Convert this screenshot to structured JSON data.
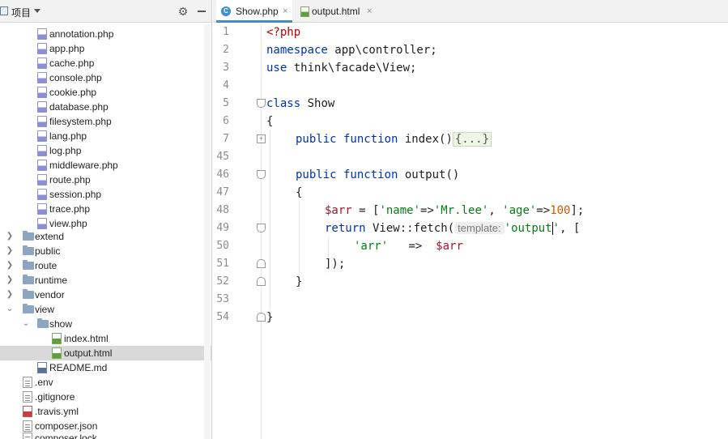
{
  "project_panel": {
    "title": "项目",
    "items": [
      {
        "label": "annotation.php",
        "icon": "php-file-icon"
      },
      {
        "label": "app.php",
        "icon": "php-file-icon"
      },
      {
        "label": "cache.php",
        "icon": "php-file-icon"
      },
      {
        "label": "console.php",
        "icon": "php-file-icon"
      },
      {
        "label": "cookie.php",
        "icon": "php-file-icon"
      },
      {
        "label": "database.php",
        "icon": "php-file-icon"
      },
      {
        "label": "filesystem.php",
        "icon": "php-file-icon"
      },
      {
        "label": "lang.php",
        "icon": "php-file-icon"
      },
      {
        "label": "log.php",
        "icon": "php-file-icon"
      },
      {
        "label": "middleware.php",
        "icon": "php-file-icon"
      },
      {
        "label": "route.php",
        "icon": "php-file-icon"
      },
      {
        "label": "session.php",
        "icon": "php-file-icon"
      },
      {
        "label": "trace.php",
        "icon": "php-file-icon"
      },
      {
        "label": "view.php",
        "icon": "php-file-icon"
      },
      {
        "label": "extend",
        "icon": "folder-icon"
      },
      {
        "label": "public",
        "icon": "folder-icon"
      },
      {
        "label": "route",
        "icon": "folder-icon"
      },
      {
        "label": "runtime",
        "icon": "folder-icon"
      },
      {
        "label": "vendor",
        "icon": "folder-icon"
      },
      {
        "label": "view",
        "icon": "folder-icon"
      },
      {
        "label": "show",
        "icon": "folder-icon"
      },
      {
        "label": "index.html",
        "icon": "html-file-icon"
      },
      {
        "label": "output.html",
        "icon": "html-file-icon"
      },
      {
        "label": "README.md",
        "icon": "markdown-file-icon"
      },
      {
        "label": ".env",
        "icon": "text-file-icon"
      },
      {
        "label": ".gitignore",
        "icon": "text-file-icon"
      },
      {
        "label": ".travis.yml",
        "icon": "yml-file-icon"
      },
      {
        "label": "composer.json",
        "icon": "text-file-icon"
      },
      {
        "label": "composer.lock",
        "icon": "text-file-icon"
      }
    ]
  },
  "tabs": [
    {
      "label": "Show.php",
      "close": "×",
      "icon": "php-class-icon"
    },
    {
      "label": "output.html",
      "close": "×",
      "icon": "html-file-icon"
    }
  ],
  "editor": {
    "line_numbers": [
      "1",
      "2",
      "3",
      "4",
      "5",
      "6",
      "7",
      "45",
      "46",
      "47",
      "48",
      "49",
      "50",
      "51",
      "52",
      "53",
      "54"
    ],
    "code": {
      "l1": "<?php",
      "l2_kw": "namespace",
      "l2_rest": " app\\controller;",
      "l3_kw": "use",
      "l3_rest": " think\\facade\\View;",
      "l5_kw": "class",
      "l5_rest": " Show",
      "l6": "{",
      "l7_kw": "public function",
      "l7_name": " index()",
      "l7_fold": "{...}",
      "l46_kw": "public function",
      "l46_name": " output()",
      "l47": "{",
      "l48_var": "$arr",
      "l48_eq": " = [",
      "l48_s1": "'name'",
      "l48_arrow1": "=>",
      "l48_s2": "'Mr.lee'",
      "l48_comma": ", ",
      "l48_s3": "'age'",
      "l48_arrow2": "=>",
      "l48_num": "100",
      "l48_end": "];",
      "l49_kw": "return",
      "l49_call": " View::fetch(",
      "l49_hint": "template:",
      "l49_str_a": "'output",
      "l49_str_b": "'",
      "l49_end": ", [",
      "l50_str": "'arr'",
      "l50_arrow": "   =>  ",
      "l50_var": "$arr",
      "l51": "]);",
      "l52": "}",
      "l54": "}"
    }
  },
  "colors": {
    "keyword": "#0033b3",
    "string": "#067d17",
    "variable": "#a0172f",
    "number": "#d05a00",
    "php_tag": "#c00000",
    "tab_underline": "#4a88c7",
    "selection": "#d9d9d9"
  }
}
